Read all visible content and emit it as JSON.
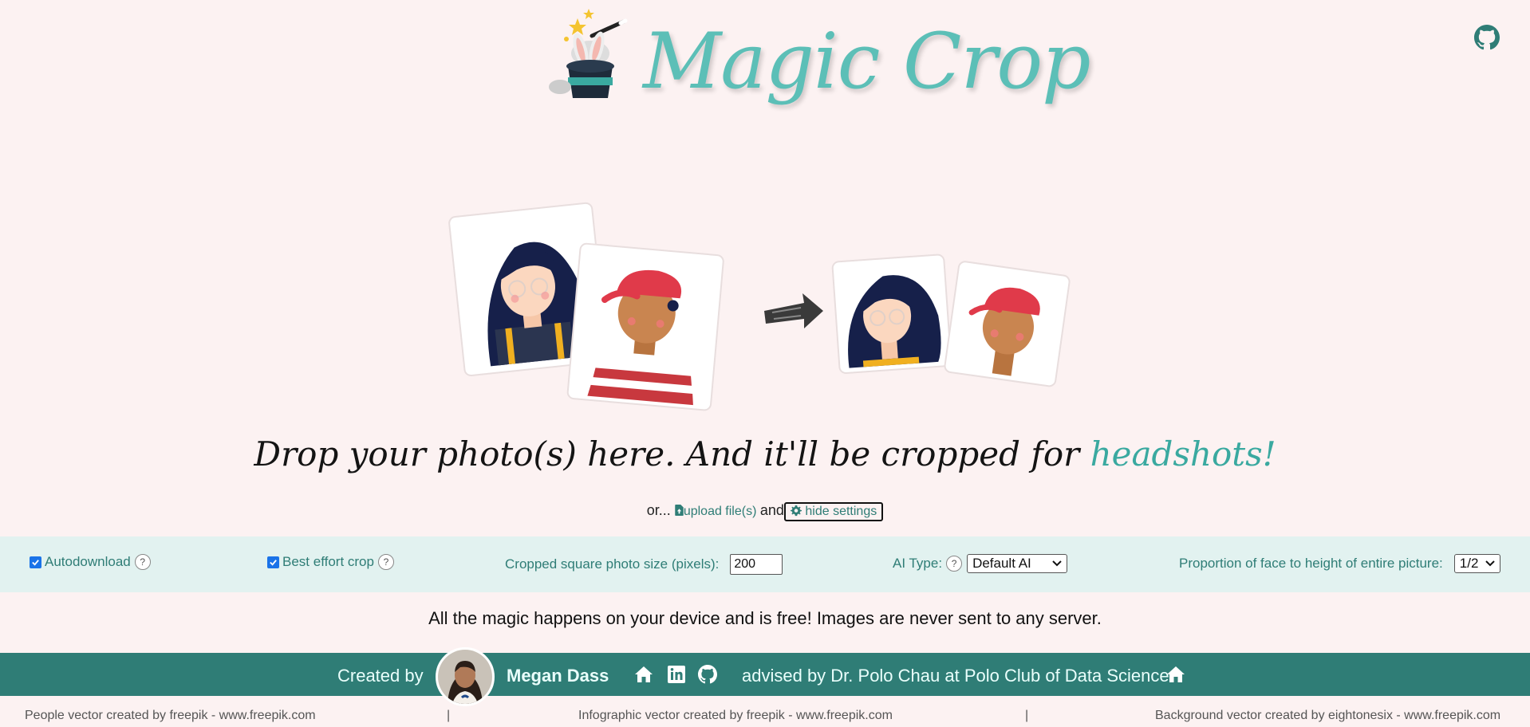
{
  "header": {
    "logo_text": "Magic Crop"
  },
  "hero": {
    "tagline_main": "Drop your photo(s) here. And it'll be cropped for ",
    "tagline_accent": "headshots!"
  },
  "upload_row": {
    "prefix": "or...",
    "upload_label": "upload file(s)",
    "and": "and",
    "settings_label": "hide settings"
  },
  "settings": {
    "autodownload_label": "Autodownload",
    "autodownload_checked": true,
    "best_effort_label": "Best effort crop",
    "best_effort_checked": true,
    "size_label": "Cropped square photo size (pixels):",
    "size_value": "200",
    "ai_type_label": "AI Type:",
    "ai_type_value": "Default AI",
    "proportion_label": "Proportion of face to height of entire picture:",
    "proportion_value": "1/2",
    "help_glyph": "?"
  },
  "privacy_text": "All the magic happens on your device and is free! Images are never sent to any server.",
  "footer": {
    "created_by": "Created by",
    "author": "Megan Dass",
    "advised": "advised by Dr. Polo Chau at Polo Club of Data Science"
  },
  "credits": {
    "people": "People vector created by freepik - www.freepik.com",
    "sep": "|",
    "infographic": "Infographic vector created by freepik - www.freepik.com",
    "background": "Background vector created by eightonesix - www.freepik.com"
  },
  "icons": {
    "github": "github-icon",
    "home": "home-icon",
    "linkedin": "linkedin-icon",
    "upload": "file-upload-icon",
    "gear": "gear-icon"
  },
  "colors": {
    "background": "#fcf2f2",
    "accent": "#5cbfb7",
    "teal_dark": "#2f7d76",
    "settings_bg": "#e2f2f0"
  }
}
